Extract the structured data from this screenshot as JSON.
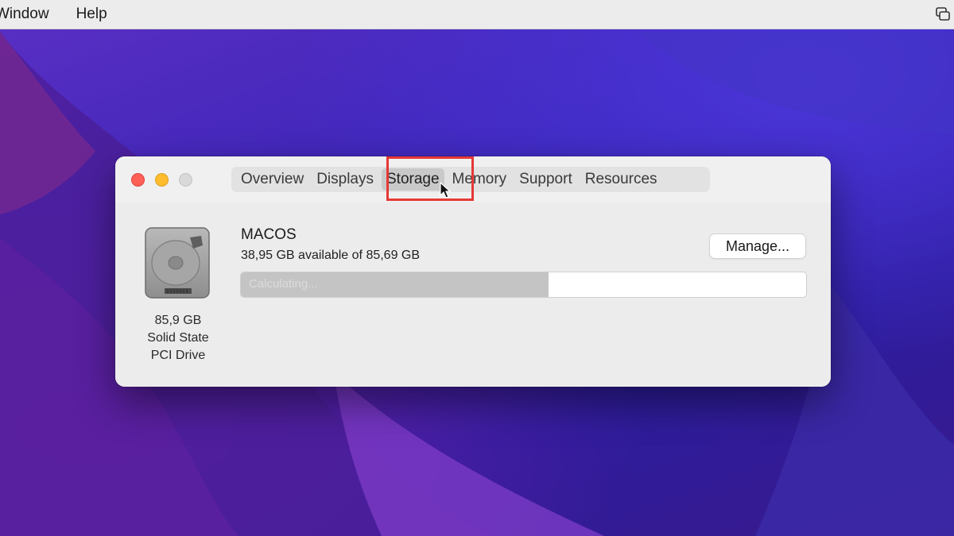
{
  "menubar": {
    "items": [
      "Window",
      "Help"
    ]
  },
  "window": {
    "tabs": [
      "Overview",
      "Displays",
      "Storage",
      "Memory",
      "Support",
      "Resources"
    ],
    "selected_tab": "Storage",
    "drive": {
      "capacity": "85,9 GB",
      "type_line1": "Solid State",
      "type_line2": "PCI Drive"
    },
    "volume": {
      "name": "MACOS",
      "available_text": "38,95 GB available of 85,69 GB",
      "manage_label": "Manage...",
      "bar_label": "Calculating...",
      "used_fraction": 0.545
    }
  },
  "colors": {
    "close": "#fe5f57",
    "minimize": "#febc2e",
    "zoom_inactive": "#d9d9d9",
    "highlight": "#e53935"
  }
}
